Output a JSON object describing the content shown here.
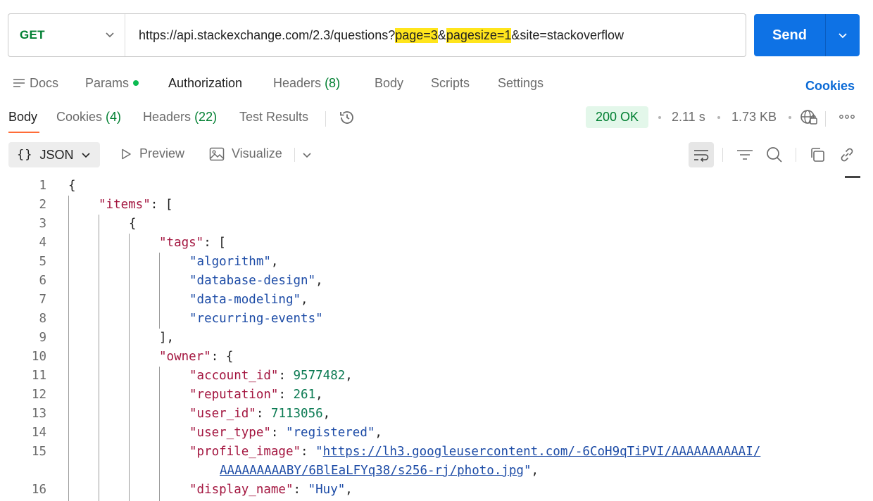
{
  "request": {
    "method": "GET",
    "url_parts": [
      {
        "text": "https://api.stackexchange.com/2.3/questions?",
        "hl": false
      },
      {
        "text": "page=3",
        "hl": true
      },
      {
        "text": "&",
        "hl": false
      },
      {
        "text": "pagesize=1",
        "hl": true
      },
      {
        "text": "&site=stackoverflow",
        "hl": false
      }
    ],
    "send_label": "Send"
  },
  "request_tabs": {
    "docs": "Docs",
    "params": "Params",
    "authorization": "Authorization",
    "headers": "Headers",
    "headers_count": "(8)",
    "body": "Body",
    "scripts": "Scripts",
    "settings": "Settings",
    "cookies_link": "Cookies"
  },
  "response_tabs": {
    "body": "Body",
    "cookies": "Cookies",
    "cookies_count": "(4)",
    "headers": "Headers",
    "headers_count": "(22)",
    "test_results": "Test Results"
  },
  "response_meta": {
    "status": "200 OK",
    "time": "2.11 s",
    "size": "1.73 KB"
  },
  "body_toolbar": {
    "format": "JSON",
    "preview": "Preview",
    "visualize": "Visualize"
  },
  "code_lines": [
    {
      "n": "1",
      "indent": 0,
      "tokens": [
        {
          "t": "{",
          "c": "p"
        }
      ]
    },
    {
      "n": "2",
      "indent": 1,
      "tokens": [
        {
          "t": "\"items\"",
          "c": "k"
        },
        {
          "t": ": [",
          "c": "p"
        }
      ]
    },
    {
      "n": "3",
      "indent": 2,
      "tokens": [
        {
          "t": "{",
          "c": "p"
        }
      ]
    },
    {
      "n": "4",
      "indent": 3,
      "tokens": [
        {
          "t": "\"tags\"",
          "c": "k"
        },
        {
          "t": ": [",
          "c": "p"
        }
      ]
    },
    {
      "n": "5",
      "indent": 4,
      "tokens": [
        {
          "t": "\"algorithm\"",
          "c": "s"
        },
        {
          "t": ",",
          "c": "p"
        }
      ]
    },
    {
      "n": "6",
      "indent": 4,
      "tokens": [
        {
          "t": "\"database-design\"",
          "c": "s"
        },
        {
          "t": ",",
          "c": "p"
        }
      ]
    },
    {
      "n": "7",
      "indent": 4,
      "tokens": [
        {
          "t": "\"data-modeling\"",
          "c": "s"
        },
        {
          "t": ",",
          "c": "p"
        }
      ]
    },
    {
      "n": "8",
      "indent": 4,
      "tokens": [
        {
          "t": "\"recurring-events\"",
          "c": "s"
        }
      ]
    },
    {
      "n": "9",
      "indent": 3,
      "tokens": [
        {
          "t": "],",
          "c": "p"
        }
      ]
    },
    {
      "n": "10",
      "indent": 3,
      "tokens": [
        {
          "t": "\"owner\"",
          "c": "k"
        },
        {
          "t": ": {",
          "c": "p"
        }
      ]
    },
    {
      "n": "11",
      "indent": 4,
      "tokens": [
        {
          "t": "\"account_id\"",
          "c": "k"
        },
        {
          "t": ": ",
          "c": "p"
        },
        {
          "t": "9577482",
          "c": "n"
        },
        {
          "t": ",",
          "c": "p"
        }
      ]
    },
    {
      "n": "12",
      "indent": 4,
      "tokens": [
        {
          "t": "\"reputation\"",
          "c": "k"
        },
        {
          "t": ": ",
          "c": "p"
        },
        {
          "t": "261",
          "c": "n"
        },
        {
          "t": ",",
          "c": "p"
        }
      ]
    },
    {
      "n": "13",
      "indent": 4,
      "tokens": [
        {
          "t": "\"user_id\"",
          "c": "k"
        },
        {
          "t": ": ",
          "c": "p"
        },
        {
          "t": "7113056",
          "c": "n"
        },
        {
          "t": ",",
          "c": "p"
        }
      ]
    },
    {
      "n": "14",
      "indent": 4,
      "tokens": [
        {
          "t": "\"user_type\"",
          "c": "k"
        },
        {
          "t": ": ",
          "c": "p"
        },
        {
          "t": "\"registered\"",
          "c": "s"
        },
        {
          "t": ",",
          "c": "p"
        }
      ]
    },
    {
      "n": "15",
      "indent": 4,
      "tokens": [
        {
          "t": "\"profile_image\"",
          "c": "k"
        },
        {
          "t": ": ",
          "c": "p"
        },
        {
          "t": "\"",
          "c": "s"
        },
        {
          "t": "https://lh3.googleusercontent.com/-6CoH9qTiPVI/AAAAAAAAAAI/",
          "c": "u"
        }
      ]
    },
    {
      "n": "",
      "indent": 5,
      "tokens": [
        {
          "t": "AAAAAAAAABY/6BlEaLFYq38/s256-rj/photo.jpg",
          "c": "u"
        },
        {
          "t": "\"",
          "c": "s"
        },
        {
          "t": ",",
          "c": "p"
        }
      ]
    },
    {
      "n": "16",
      "indent": 4,
      "tokens": [
        {
          "t": "\"display_name\"",
          "c": "k"
        },
        {
          "t": ": ",
          "c": "p"
        },
        {
          "t": "\"Huy\"",
          "c": "s"
        },
        {
          "t": ",",
          "c": "p"
        }
      ]
    }
  ],
  "colors": {
    "accent_send": "#0e72e5",
    "method_get": "#007f31",
    "status_ok_bg": "#e3f7ea",
    "active_tab_underline": "#ff6c37",
    "url_highlight": "#ffe51c"
  }
}
